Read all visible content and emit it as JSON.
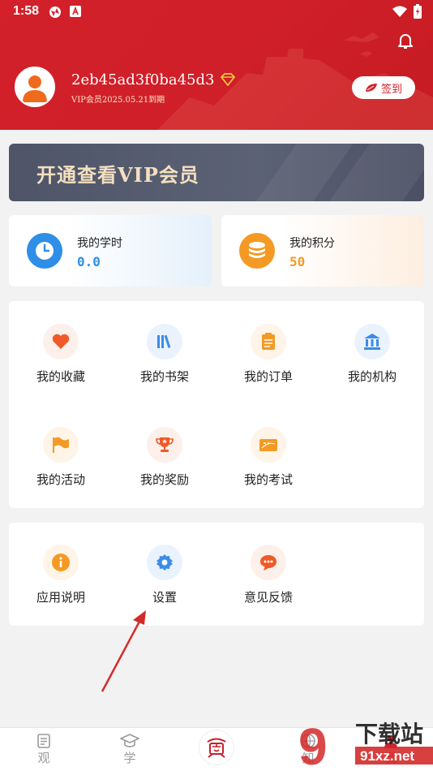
{
  "status_bar": {
    "time": "1:58"
  },
  "profile": {
    "username": "2eb45ad3f0ba45d3",
    "vip_expiry": "VIP会员2025.05.21到期",
    "signin_label": "签到"
  },
  "vip_banner": {
    "text": "开通查看VIP会员"
  },
  "stats": {
    "hours_label": "我的学时",
    "hours_value": "0.0",
    "points_label": "我的积分",
    "points_value": "50"
  },
  "menu_main": [
    {
      "label": "我的收藏",
      "icon": "heart-icon",
      "color": "#ef5a28"
    },
    {
      "label": "我的书架",
      "icon": "bookshelf-icon",
      "color": "#3b8de6"
    },
    {
      "label": "我的订单",
      "icon": "order-icon",
      "color": "#f49a24"
    },
    {
      "label": "我的机构",
      "icon": "institution-icon",
      "color": "#3b8de6"
    },
    {
      "label": "我的活动",
      "icon": "flag-icon",
      "color": "#f49a24"
    },
    {
      "label": "我的奖励",
      "icon": "trophy-icon",
      "color": "#ef5a28"
    },
    {
      "label": "我的考试",
      "icon": "exam-icon",
      "color": "#f49a24"
    }
  ],
  "menu_secondary": [
    {
      "label": "应用说明",
      "icon": "info-icon",
      "color": "#f49a24"
    },
    {
      "label": "设置",
      "icon": "gear-icon",
      "color": "#3b8de6"
    },
    {
      "label": "意见反馈",
      "icon": "feedback-icon",
      "color": "#ef5a28"
    }
  ],
  "bottom_nav": {
    "items": [
      "观",
      "学",
      "",
      "知",
      "我"
    ]
  },
  "watermark": {
    "text_top": "下载站",
    "text_bottom": "91xz.net"
  },
  "colors": {
    "header_red": "#d3202a",
    "vip_gold": "#f3dfbf",
    "blue": "#3b8de6",
    "orange": "#f49a24",
    "red_orange": "#ef5a28"
  }
}
